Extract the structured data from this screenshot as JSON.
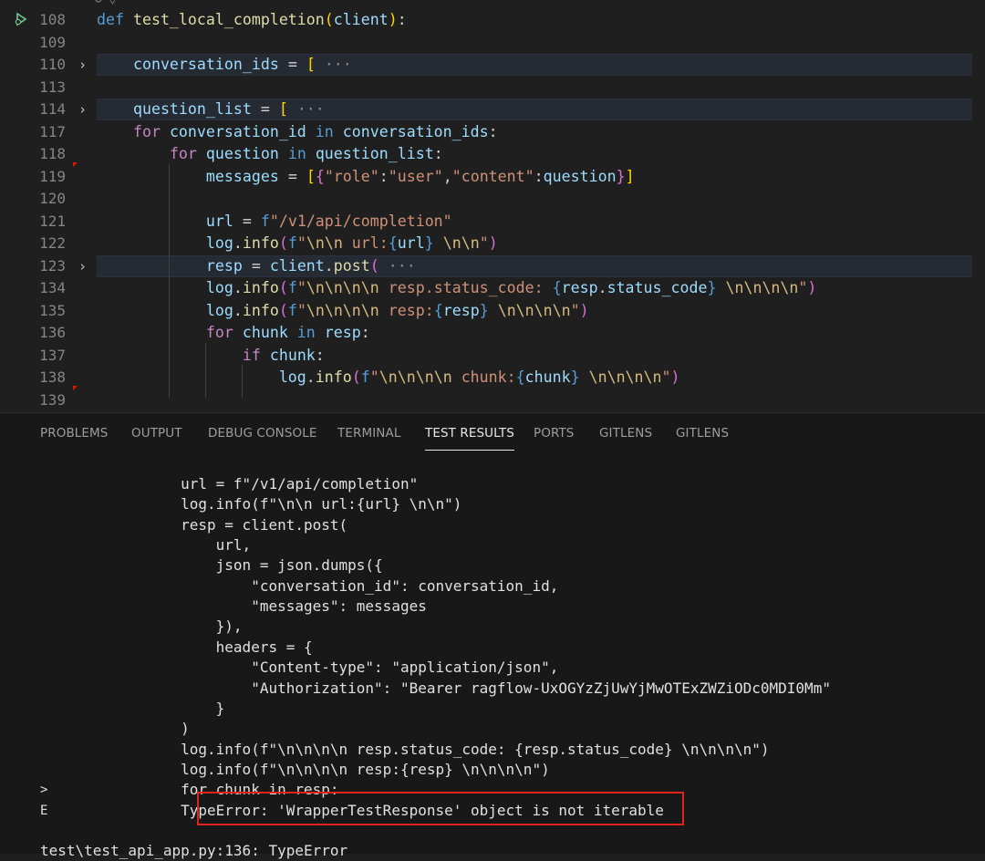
{
  "editor": {
    "lines": [
      {
        "no": "108",
        "fold": false,
        "hl": false,
        "tokens": [
          {
            "t": "def ",
            "c": "kw"
          },
          {
            "t": "test_local_completion",
            "c": "fn"
          },
          {
            "t": "(",
            "c": "br1"
          },
          {
            "t": "client",
            "c": "var"
          },
          {
            "t": ")",
            "c": "br1"
          },
          {
            "t": ":"
          }
        ]
      },
      {
        "no": "109",
        "fold": false,
        "hl": false,
        "tokens": []
      },
      {
        "no": "110",
        "fold": true,
        "hl": true,
        "tokens": [
          {
            "t": "    "
          },
          {
            "t": "conversation_ids",
            "c": "var"
          },
          {
            "t": " = "
          },
          {
            "t": "[",
            "c": "br1"
          },
          {
            "t": " ···",
            "c": "ell"
          }
        ]
      },
      {
        "no": "113",
        "fold": false,
        "hl": false,
        "tokens": []
      },
      {
        "no": "114",
        "fold": true,
        "hl": true,
        "tokens": [
          {
            "t": "    "
          },
          {
            "t": "question_list",
            "c": "var"
          },
          {
            "t": " = "
          },
          {
            "t": "[",
            "c": "br1"
          },
          {
            "t": " ···",
            "c": "ell"
          }
        ]
      },
      {
        "no": "117",
        "fold": false,
        "hl": false,
        "tokens": [
          {
            "t": "    "
          },
          {
            "t": "for ",
            "c": "kw2"
          },
          {
            "t": "conversation_id",
            "c": "var"
          },
          {
            "t": " in ",
            "c": "kw"
          },
          {
            "t": "conversation_ids",
            "c": "var"
          },
          {
            "t": ":"
          }
        ]
      },
      {
        "no": "118",
        "fold": false,
        "hl": false,
        "tokens": [
          {
            "t": "        "
          },
          {
            "t": "for ",
            "c": "kw2"
          },
          {
            "t": "question",
            "c": "var"
          },
          {
            "t": " in ",
            "c": "kw"
          },
          {
            "t": "question_list",
            "c": "var"
          },
          {
            "t": ":"
          }
        ]
      },
      {
        "no": "119",
        "fold": false,
        "hl": false,
        "tokens": [
          {
            "t": "            "
          },
          {
            "t": "messages",
            "c": "var"
          },
          {
            "t": " = "
          },
          {
            "t": "[",
            "c": "br1"
          },
          {
            "t": "{",
            "c": "br2"
          },
          {
            "t": "\"role\"",
            "c": "str"
          },
          {
            "t": ":"
          },
          {
            "t": "\"user\"",
            "c": "str"
          },
          {
            "t": ","
          },
          {
            "t": "\"content\"",
            "c": "str"
          },
          {
            "t": ":"
          },
          {
            "t": "question",
            "c": "var"
          },
          {
            "t": "}",
            "c": "br2"
          },
          {
            "t": "]",
            "c": "br1"
          }
        ]
      },
      {
        "no": "120",
        "fold": false,
        "hl": false,
        "tokens": []
      },
      {
        "no": "121",
        "fold": false,
        "hl": false,
        "tokens": [
          {
            "t": "            "
          },
          {
            "t": "url",
            "c": "var"
          },
          {
            "t": " = "
          },
          {
            "t": "f",
            "c": "kw"
          },
          {
            "t": "\"/v1/api/completion\"",
            "c": "str"
          }
        ]
      },
      {
        "no": "122",
        "fold": false,
        "hl": false,
        "tokens": [
          {
            "t": "            "
          },
          {
            "t": "log",
            "c": "var"
          },
          {
            "t": "."
          },
          {
            "t": "info",
            "c": "fn"
          },
          {
            "t": "(",
            "c": "br2"
          },
          {
            "t": "f",
            "c": "kw"
          },
          {
            "t": "\"",
            "c": "str"
          },
          {
            "t": "\\n\\n",
            "c": "esc"
          },
          {
            "t": " url:",
            "c": "str"
          },
          {
            "t": "{",
            "c": "kw"
          },
          {
            "t": "url",
            "c": "var"
          },
          {
            "t": "}",
            "c": "kw"
          },
          {
            "t": " ",
            "c": "str"
          },
          {
            "t": "\\n\\n",
            "c": "esc"
          },
          {
            "t": "\"",
            "c": "str"
          },
          {
            "t": ")",
            "c": "br2"
          }
        ]
      },
      {
        "no": "123",
        "fold": true,
        "hl": true,
        "tokens": [
          {
            "t": "            "
          },
          {
            "t": "resp",
            "c": "var"
          },
          {
            "t": " = "
          },
          {
            "t": "client",
            "c": "var"
          },
          {
            "t": "."
          },
          {
            "t": "post",
            "c": "fn"
          },
          {
            "t": "(",
            "c": "br2"
          },
          {
            "t": " ···",
            "c": "ell"
          }
        ]
      },
      {
        "no": "134",
        "fold": false,
        "hl": false,
        "tokens": [
          {
            "t": "            "
          },
          {
            "t": "log",
            "c": "var"
          },
          {
            "t": "."
          },
          {
            "t": "info",
            "c": "fn"
          },
          {
            "t": "(",
            "c": "br2"
          },
          {
            "t": "f",
            "c": "kw"
          },
          {
            "t": "\"",
            "c": "str"
          },
          {
            "t": "\\n\\n\\n\\n",
            "c": "esc"
          },
          {
            "t": " resp.status_code: ",
            "c": "str"
          },
          {
            "t": "{",
            "c": "kw"
          },
          {
            "t": "resp",
            "c": "var"
          },
          {
            "t": "."
          },
          {
            "t": "status_code",
            "c": "var"
          },
          {
            "t": "}",
            "c": "kw"
          },
          {
            "t": " ",
            "c": "str"
          },
          {
            "t": "\\n\\n\\n\\n",
            "c": "esc"
          },
          {
            "t": "\"",
            "c": "str"
          },
          {
            "t": ")",
            "c": "br2"
          }
        ]
      },
      {
        "no": "135",
        "fold": false,
        "hl": false,
        "tokens": [
          {
            "t": "            "
          },
          {
            "t": "log",
            "c": "var"
          },
          {
            "t": "."
          },
          {
            "t": "info",
            "c": "fn"
          },
          {
            "t": "(",
            "c": "br2"
          },
          {
            "t": "f",
            "c": "kw"
          },
          {
            "t": "\"",
            "c": "str"
          },
          {
            "t": "\\n\\n\\n\\n",
            "c": "esc"
          },
          {
            "t": " resp:",
            "c": "str"
          },
          {
            "t": "{",
            "c": "kw"
          },
          {
            "t": "resp",
            "c": "var"
          },
          {
            "t": "}",
            "c": "kw"
          },
          {
            "t": " ",
            "c": "str"
          },
          {
            "t": "\\n\\n\\n\\n",
            "c": "esc"
          },
          {
            "t": "\"",
            "c": "str"
          },
          {
            "t": ")",
            "c": "br2"
          }
        ]
      },
      {
        "no": "136",
        "fold": false,
        "hl": false,
        "tokens": [
          {
            "t": "            "
          },
          {
            "t": "for ",
            "c": "kw2"
          },
          {
            "t": "chunk",
            "c": "var"
          },
          {
            "t": " in ",
            "c": "kw"
          },
          {
            "t": "resp",
            "c": "var"
          },
          {
            "t": ":"
          }
        ]
      },
      {
        "no": "137",
        "fold": false,
        "hl": false,
        "tokens": [
          {
            "t": "                "
          },
          {
            "t": "if ",
            "c": "kw2"
          },
          {
            "t": "chunk",
            "c": "var"
          },
          {
            "t": ":"
          }
        ]
      },
      {
        "no": "138",
        "fold": false,
        "hl": false,
        "tokens": [
          {
            "t": "                    "
          },
          {
            "t": "log",
            "c": "var"
          },
          {
            "t": "."
          },
          {
            "t": "info",
            "c": "fn"
          },
          {
            "t": "(",
            "c": "br2"
          },
          {
            "t": "f",
            "c": "kw"
          },
          {
            "t": "\"",
            "c": "str"
          },
          {
            "t": "\\n\\n\\n\\n",
            "c": "esc"
          },
          {
            "t": " chunk:",
            "c": "str"
          },
          {
            "t": "{",
            "c": "kw"
          },
          {
            "t": "chunk",
            "c": "var"
          },
          {
            "t": "}",
            "c": "kw"
          },
          {
            "t": " ",
            "c": "str"
          },
          {
            "t": "\\n\\n\\n\\n",
            "c": "esc"
          },
          {
            "t": "\"",
            "c": "str"
          },
          {
            "t": ")",
            "c": "br2"
          }
        ]
      },
      {
        "no": "139",
        "fold": false,
        "hl": false,
        "tokens": []
      }
    ]
  },
  "panel": {
    "tabs": [
      {
        "label": "PROBLEMS",
        "active": false
      },
      {
        "label": "OUTPUT",
        "active": false
      },
      {
        "label": "DEBUG CONSOLE",
        "active": false
      },
      {
        "label": "TERMINAL",
        "active": false
      },
      {
        "label": "TEST RESULTS",
        "active": true
      },
      {
        "label": "PORTS",
        "active": false
      },
      {
        "label": "GITLENS",
        "active": false
      },
      {
        "label": "GITLENS",
        "active": false
      }
    ],
    "output": [
      {
        "marker": "",
        "text": "                url = f\"/v1/api/completion\""
      },
      {
        "marker": "",
        "text": "                log.info(f\"\\n\\n url:{url} \\n\\n\")"
      },
      {
        "marker": "",
        "text": "                resp = client.post("
      },
      {
        "marker": "",
        "text": "                    url,"
      },
      {
        "marker": "",
        "text": "                    json = json.dumps({"
      },
      {
        "marker": "",
        "text": "                        \"conversation_id\": conversation_id,"
      },
      {
        "marker": "",
        "text": "                        \"messages\": messages"
      },
      {
        "marker": "",
        "text": "                    }),"
      },
      {
        "marker": "",
        "text": "                    headers = {"
      },
      {
        "marker": "",
        "text": "                        \"Content-type\": \"application/json\","
      },
      {
        "marker": "",
        "text": "                        \"Authorization\": \"Bearer ragflow-UxOGYzZjUwYjMwOTExZWZiODc0MDI0Mm\""
      },
      {
        "marker": "",
        "text": "                    }"
      },
      {
        "marker": "",
        "text": "                )"
      },
      {
        "marker": "",
        "text": "                log.info(f\"\\n\\n\\n\\n resp.status_code: {resp.status_code} \\n\\n\\n\\n\")"
      },
      {
        "marker": "",
        "text": "                log.info(f\"\\n\\n\\n\\n resp:{resp} \\n\\n\\n\\n\")"
      },
      {
        "marker": ">",
        "text": "                for chunk in resp:"
      },
      {
        "marker": "E",
        "text": "                TypeError: 'WrapperTestResponse' object is not iterable"
      },
      {
        "marker": "",
        "text": ""
      },
      {
        "marker": "",
        "text": "test\\test_api_app.py:136: TypeError"
      }
    ]
  },
  "colors": {
    "accent_error_box": "#e0241b",
    "editor_bg": "#1f1f1f",
    "panel_bg": "#181818"
  }
}
